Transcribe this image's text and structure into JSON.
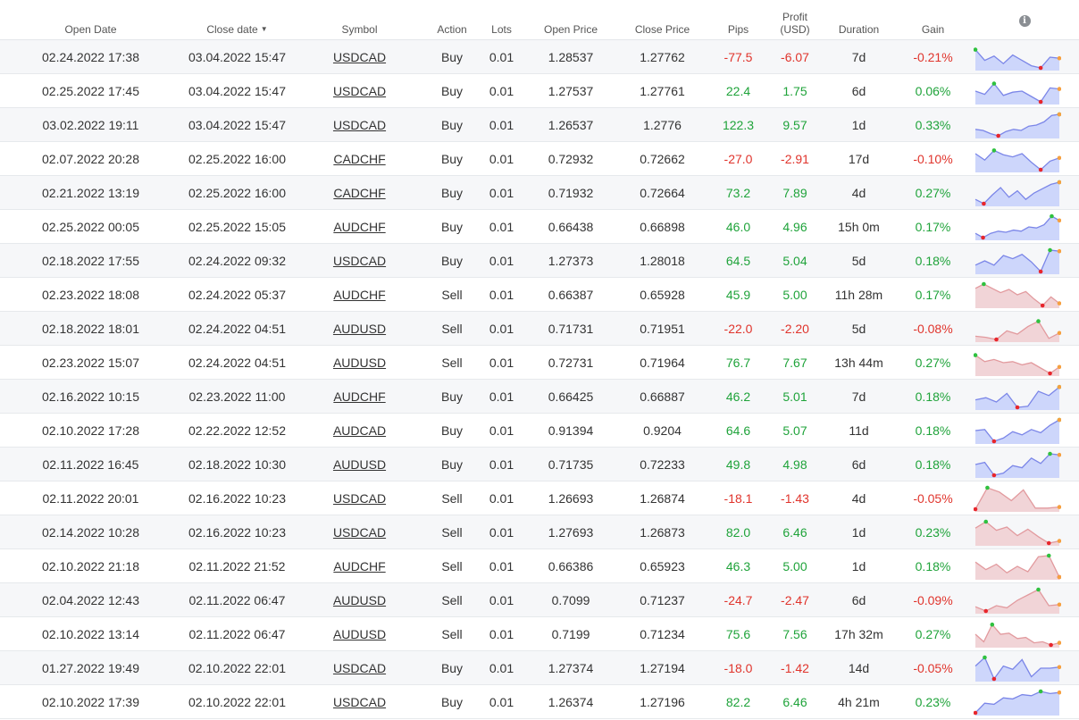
{
  "headers": {
    "open_date": "Open Date",
    "close_date": "Close date",
    "sort_arrow": "▼",
    "symbol": "Symbol",
    "action": "Action",
    "lots": "Lots",
    "open_price": "Open Price",
    "close_price": "Close Price",
    "pips": "Pips",
    "profit_line1": "Profit",
    "profit_line2": "(USD)",
    "duration": "Duration",
    "gain": "Gain",
    "info_icon": "i"
  },
  "colors": {
    "positive": "#1fa33a",
    "negative": "#e0342c",
    "buy_line": "#7b86e8",
    "buy_fill": "#cdd6fb",
    "sell_line": "#e29a9e",
    "sell_fill": "#f1d4d7",
    "max_marker": "#2fc13f",
    "min_marker": "#e8262c",
    "end_marker": "#f6a040"
  },
  "rows": [
    {
      "open_date": "02.24.2022 17:38",
      "close_date": "03.04.2022 15:47",
      "symbol": "USDCAD",
      "action": "Buy",
      "lots": "0.01",
      "open_price": "1.28537",
      "close_price": "1.27762",
      "pips": "-77.5",
      "profit": "-6.07",
      "duration": "7d",
      "gain": "-0.21%",
      "sign": "neg",
      "spark": [
        0.85,
        0.35,
        0.55,
        0.2,
        0.6,
        0.35,
        0.1,
        0.0,
        0.5,
        0.45
      ]
    },
    {
      "open_date": "02.25.2022 17:45",
      "close_date": "03.04.2022 15:47",
      "symbol": "USDCAD",
      "action": "Buy",
      "lots": "0.01",
      "open_price": "1.27537",
      "close_price": "1.27761",
      "pips": "22.4",
      "profit": "1.75",
      "duration": "6d",
      "gain": "0.06%",
      "sign": "pos",
      "spark": [
        0.5,
        0.35,
        0.85,
        0.3,
        0.45,
        0.5,
        0.25,
        0.0,
        0.65,
        0.6
      ]
    },
    {
      "open_date": "03.02.2022 19:11",
      "close_date": "03.04.2022 15:47",
      "symbol": "USDCAD",
      "action": "Buy",
      "lots": "0.01",
      "open_price": "1.26537",
      "close_price": "1.2776",
      "pips": "122.3",
      "profit": "9.57",
      "duration": "1d",
      "gain": "0.33%",
      "sign": "pos",
      "spark": [
        0.3,
        0.25,
        0.1,
        0.0,
        0.2,
        0.3,
        0.25,
        0.45,
        0.5,
        0.65,
        0.95,
        1.0
      ]
    },
    {
      "open_date": "02.07.2022 20:28",
      "close_date": "02.25.2022 16:00",
      "symbol": "CADCHF",
      "action": "Buy",
      "lots": "0.01",
      "open_price": "0.72932",
      "close_price": "0.72662",
      "pips": "-27.0",
      "profit": "-2.91",
      "duration": "17d",
      "gain": "-0.10%",
      "sign": "neg",
      "spark": [
        0.75,
        0.45,
        0.9,
        0.7,
        0.6,
        0.75,
        0.35,
        0.0,
        0.4,
        0.55
      ]
    },
    {
      "open_date": "02.21.2022 13:19",
      "close_date": "02.25.2022 16:00",
      "symbol": "CADCHF",
      "action": "Buy",
      "lots": "0.01",
      "open_price": "0.71932",
      "close_price": "0.72664",
      "pips": "73.2",
      "profit": "7.89",
      "duration": "4d",
      "gain": "0.27%",
      "sign": "pos",
      "spark": [
        0.2,
        0.0,
        0.4,
        0.75,
        0.3,
        0.6,
        0.2,
        0.5,
        0.7,
        0.9,
        1.0
      ]
    },
    {
      "open_date": "02.25.2022 00:05",
      "close_date": "02.25.2022 15:05",
      "symbol": "AUDCHF",
      "action": "Buy",
      "lots": "0.01",
      "open_price": "0.66438",
      "close_price": "0.66898",
      "pips": "46.0",
      "profit": "4.96",
      "duration": "15h 0m",
      "gain": "0.17%",
      "sign": "pos",
      "spark": [
        0.2,
        0.0,
        0.2,
        0.3,
        0.25,
        0.35,
        0.3,
        0.5,
        0.45,
        0.6,
        1.0,
        0.8
      ]
    },
    {
      "open_date": "02.18.2022 17:55",
      "close_date": "02.24.2022 09:32",
      "symbol": "USDCAD",
      "action": "Buy",
      "lots": "0.01",
      "open_price": "1.27373",
      "close_price": "1.28018",
      "pips": "64.5",
      "profit": "5.04",
      "duration": "5d",
      "gain": "0.18%",
      "sign": "pos",
      "spark": [
        0.3,
        0.5,
        0.3,
        0.75,
        0.6,
        0.8,
        0.45,
        0.0,
        1.0,
        0.95
      ]
    },
    {
      "open_date": "02.23.2022 18:08",
      "close_date": "02.24.2022 05:37",
      "symbol": "AUDCHF",
      "action": "Sell",
      "lots": "0.01",
      "open_price": "0.66387",
      "close_price": "0.65928",
      "pips": "45.9",
      "profit": "5.00",
      "duration": "11h 28m",
      "gain": "0.17%",
      "sign": "pos",
      "spark": [
        0.8,
        1.0,
        0.8,
        0.6,
        0.75,
        0.5,
        0.65,
        0.3,
        0.0,
        0.4,
        0.1
      ]
    },
    {
      "open_date": "02.18.2022 18:01",
      "close_date": "02.24.2022 04:51",
      "symbol": "AUDUSD",
      "action": "Sell",
      "lots": "0.01",
      "open_price": "0.71731",
      "close_price": "0.71951",
      "pips": "-22.0",
      "profit": "-2.20",
      "duration": "5d",
      "gain": "-0.08%",
      "sign": "neg",
      "spark": [
        0.15,
        0.1,
        0.0,
        0.4,
        0.25,
        0.6,
        0.85,
        0.05,
        0.3
      ]
    },
    {
      "open_date": "02.23.2022 15:07",
      "close_date": "02.24.2022 04:51",
      "symbol": "AUDUSD",
      "action": "Sell",
      "lots": "0.01",
      "open_price": "0.72731",
      "close_price": "0.71964",
      "pips": "76.7",
      "profit": "7.67",
      "duration": "13h 44m",
      "gain": "0.27%",
      "sign": "pos",
      "spark": [
        0.85,
        0.55,
        0.65,
        0.5,
        0.55,
        0.4,
        0.5,
        0.25,
        0.0,
        0.3
      ]
    },
    {
      "open_date": "02.16.2022 10:15",
      "close_date": "02.23.2022 11:00",
      "symbol": "AUDCHF",
      "action": "Buy",
      "lots": "0.01",
      "open_price": "0.66425",
      "close_price": "0.66887",
      "pips": "46.2",
      "profit": "5.01",
      "duration": "7d",
      "gain": "0.18%",
      "sign": "pos",
      "spark": [
        0.35,
        0.45,
        0.25,
        0.65,
        0.0,
        0.05,
        0.75,
        0.55,
        0.95
      ]
    },
    {
      "open_date": "02.10.2022 17:28",
      "close_date": "02.22.2022 12:52",
      "symbol": "AUDCAD",
      "action": "Buy",
      "lots": "0.01",
      "open_price": "0.91394",
      "close_price": "0.9204",
      "pips": "64.6",
      "profit": "5.07",
      "duration": "11d",
      "gain": "0.18%",
      "sign": "pos",
      "spark": [
        0.5,
        0.55,
        0.0,
        0.15,
        0.45,
        0.3,
        0.55,
        0.4,
        0.75,
        1.0
      ]
    },
    {
      "open_date": "02.11.2022 16:45",
      "close_date": "02.18.2022 10:30",
      "symbol": "AUDUSD",
      "action": "Buy",
      "lots": "0.01",
      "open_price": "0.71735",
      "close_price": "0.72233",
      "pips": "49.8",
      "profit": "4.98",
      "duration": "6d",
      "gain": "0.18%",
      "sign": "pos",
      "spark": [
        0.5,
        0.6,
        0.0,
        0.1,
        0.45,
        0.35,
        0.8,
        0.55,
        1.0,
        0.95
      ]
    },
    {
      "open_date": "02.11.2022 20:01",
      "close_date": "02.16.2022 10:23",
      "symbol": "USDCAD",
      "action": "Sell",
      "lots": "0.01",
      "open_price": "1.26693",
      "close_price": "1.26874",
      "pips": "-18.1",
      "profit": "-1.43",
      "duration": "4d",
      "gain": "-0.05%",
      "sign": "neg",
      "spark": [
        0.0,
        1.0,
        0.8,
        0.4,
        0.9,
        0.05,
        0.05,
        0.1
      ]
    },
    {
      "open_date": "02.14.2022 10:28",
      "close_date": "02.16.2022 10:23",
      "symbol": "USDCAD",
      "action": "Sell",
      "lots": "0.01",
      "open_price": "1.27693",
      "close_price": "1.26873",
      "pips": "82.0",
      "profit": "6.46",
      "duration": "1d",
      "gain": "0.23%",
      "sign": "pos",
      "spark": [
        0.7,
        1.0,
        0.6,
        0.75,
        0.35,
        0.65,
        0.3,
        0.0,
        0.1
      ]
    },
    {
      "open_date": "02.10.2022 21:18",
      "close_date": "02.11.2022 21:52",
      "symbol": "AUDCHF",
      "action": "Sell",
      "lots": "0.01",
      "open_price": "0.66386",
      "close_price": "0.65923",
      "pips": "46.3",
      "profit": "5.00",
      "duration": "1d",
      "gain": "0.18%",
      "sign": "pos",
      "spark": [
        0.7,
        0.35,
        0.6,
        0.2,
        0.5,
        0.25,
        0.95,
        1.0,
        0.0
      ]
    },
    {
      "open_date": "02.04.2022 12:43",
      "close_date": "02.11.2022 06:47",
      "symbol": "AUDUSD",
      "action": "Sell",
      "lots": "0.01",
      "open_price": "0.7099",
      "close_price": "0.71237",
      "pips": "-24.7",
      "profit": "-2.47",
      "duration": "6d",
      "gain": "-0.09%",
      "sign": "neg",
      "spark": [
        0.2,
        0.0,
        0.25,
        0.15,
        0.5,
        0.75,
        1.0,
        0.25,
        0.3
      ]
    },
    {
      "open_date": "02.10.2022 13:14",
      "close_date": "02.11.2022 06:47",
      "symbol": "AUDUSD",
      "action": "Sell",
      "lots": "0.01",
      "open_price": "0.7199",
      "close_price": "0.71234",
      "pips": "75.6",
      "profit": "7.56",
      "duration": "17h 32m",
      "gain": "0.27%",
      "sign": "pos",
      "spark": [
        0.5,
        0.15,
        0.95,
        0.5,
        0.55,
        0.3,
        0.35,
        0.1,
        0.15,
        0.0,
        0.1
      ]
    },
    {
      "open_date": "01.27.2022 19:49",
      "close_date": "02.10.2022 22:01",
      "symbol": "USDCAD",
      "action": "Buy",
      "lots": "0.01",
      "open_price": "1.27374",
      "close_price": "1.27194",
      "pips": "-18.0",
      "profit": "-1.42",
      "duration": "14d",
      "gain": "-0.05%",
      "sign": "neg",
      "spark": [
        0.6,
        1.0,
        0.0,
        0.6,
        0.45,
        0.9,
        0.1,
        0.5,
        0.5,
        0.55
      ]
    },
    {
      "open_date": "02.10.2022 17:39",
      "close_date": "02.10.2022 22:01",
      "symbol": "USDCAD",
      "action": "Buy",
      "lots": "0.01",
      "open_price": "1.26374",
      "close_price": "1.27196",
      "pips": "82.2",
      "profit": "6.46",
      "duration": "4h 21m",
      "gain": "0.23%",
      "sign": "pos",
      "spark": [
        0.0,
        0.45,
        0.4,
        0.7,
        0.65,
        0.85,
        0.8,
        1.0,
        0.9,
        0.95
      ]
    }
  ]
}
